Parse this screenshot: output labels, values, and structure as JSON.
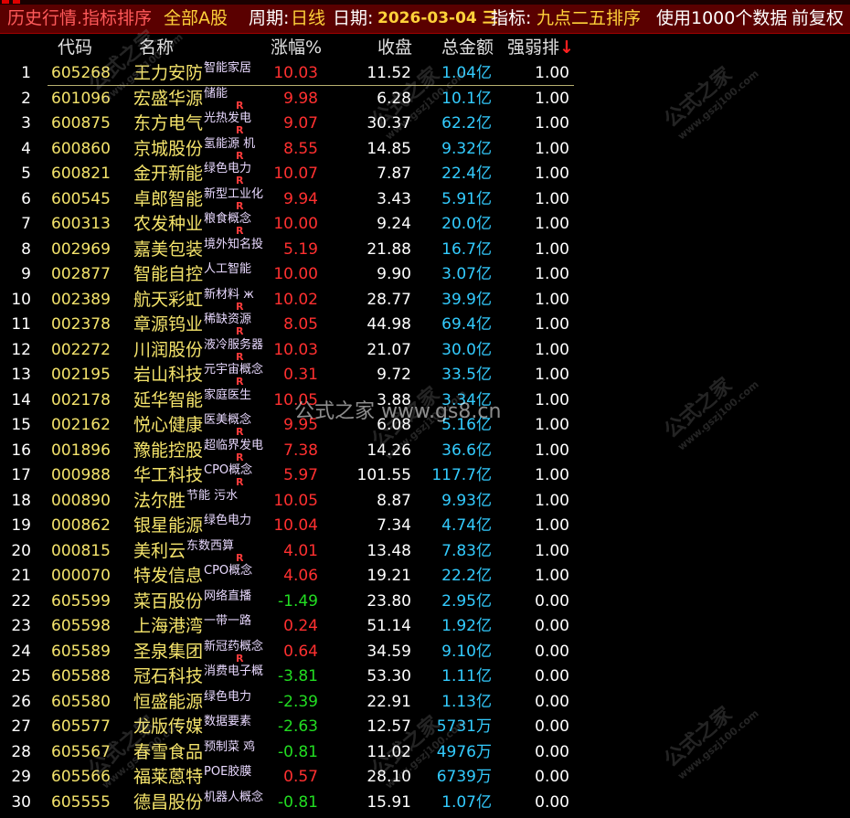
{
  "titlebar": {
    "module": "历史行情.指标排序",
    "scope": "全部A股",
    "period_label": "周期:",
    "period_value": "日线",
    "date_label": "日期:",
    "date_value": "2026-03-04 三",
    "indicator_label": "指标:",
    "indicator_value": "九点二五排序",
    "data_note": "使用1000个数据",
    "adjust": "前复权"
  },
  "columns": {
    "code": "代码",
    "name": "名称",
    "change": "涨幅%",
    "close": "收盘",
    "amount": "总金额",
    "rank": "强弱排",
    "sort_arrow": "↓"
  },
  "rows": [
    {
      "idx": "1",
      "code": "605268",
      "name": "王力安防",
      "concept": "智能家居",
      "r": "",
      "chg": "10.03",
      "dir": "up",
      "close": "11.52",
      "amt": "1.04亿",
      "rank": "1.00"
    },
    {
      "idx": "2",
      "code": "601096",
      "name": "宏盛华源",
      "concept": "储能",
      "r": "R",
      "chg": "9.98",
      "dir": "up",
      "close": "6.28",
      "amt": "10.1亿",
      "rank": "1.00"
    },
    {
      "idx": "3",
      "code": "600875",
      "name": "东方电气",
      "concept": "光热发电",
      "r": "R",
      "chg": "9.07",
      "dir": "up",
      "close": "30.37",
      "amt": "62.2亿",
      "rank": "1.00"
    },
    {
      "idx": "4",
      "code": "600860",
      "name": "京城股份",
      "concept": "氢能源 机",
      "r": "R",
      "chg": "8.55",
      "dir": "up",
      "close": "14.85",
      "amt": "9.32亿",
      "rank": "1.00"
    },
    {
      "idx": "5",
      "code": "600821",
      "name": "金开新能",
      "concept": "绿色电力",
      "r": "R",
      "chg": "10.07",
      "dir": "up",
      "close": "7.87",
      "amt": "22.4亿",
      "rank": "1.00"
    },
    {
      "idx": "6",
      "code": "600545",
      "name": "卓郎智能",
      "concept": "新型工业化",
      "r": "R",
      "chg": "9.94",
      "dir": "up",
      "close": "3.43",
      "amt": "5.91亿",
      "rank": "1.00"
    },
    {
      "idx": "7",
      "code": "600313",
      "name": "农发种业",
      "concept": "粮食概念",
      "r": "R",
      "chg": "10.00",
      "dir": "up",
      "close": "9.24",
      "amt": "20.0亿",
      "rank": "1.00"
    },
    {
      "idx": "8",
      "code": "002969",
      "name": "嘉美包装",
      "concept": "境外知名投",
      "r": "",
      "chg": "5.19",
      "dir": "up",
      "close": "21.88",
      "amt": "16.7亿",
      "rank": "1.00"
    },
    {
      "idx": "9",
      "code": "002877",
      "name": "智能自控",
      "concept": "人工智能",
      "r": "",
      "chg": "10.00",
      "dir": "up",
      "close": "9.90",
      "amt": "3.07亿",
      "rank": "1.00"
    },
    {
      "idx": "10",
      "code": "002389",
      "name": "航天彩虹",
      "concept": "新材料 ж",
      "r": "R",
      "chg": "10.02",
      "dir": "up",
      "close": "28.77",
      "amt": "39.9亿",
      "rank": "1.00"
    },
    {
      "idx": "11",
      "code": "002378",
      "name": "章源钨业",
      "concept": "稀缺资源",
      "r": "R",
      "chg": "8.05",
      "dir": "up",
      "close": "44.98",
      "amt": "69.4亿",
      "rank": "1.00"
    },
    {
      "idx": "12",
      "code": "002272",
      "name": "川润股份",
      "concept": "液冷服务器",
      "r": "R",
      "chg": "10.03",
      "dir": "up",
      "close": "21.07",
      "amt": "30.0亿",
      "rank": "1.00"
    },
    {
      "idx": "13",
      "code": "002195",
      "name": "岩山科技",
      "concept": "元宇宙概念",
      "r": "R",
      "chg": "0.31",
      "dir": "up",
      "close": "9.72",
      "amt": "33.5亿",
      "rank": "1.00"
    },
    {
      "idx": "14",
      "code": "002178",
      "name": "延华智能",
      "concept": "家庭医生",
      "r": "",
      "chg": "10.05",
      "dir": "up",
      "close": "3.88",
      "amt": "3.34亿",
      "rank": "1.00"
    },
    {
      "idx": "15",
      "code": "002162",
      "name": "悦心健康",
      "concept": "医美概念",
      "r": "R",
      "chg": "9.95",
      "dir": "up",
      "close": "6.08",
      "amt": "5.16亿",
      "rank": "1.00"
    },
    {
      "idx": "16",
      "code": "001896",
      "name": "豫能控股",
      "concept": "超临界发电",
      "r": "R",
      "chg": "7.38",
      "dir": "up",
      "close": "14.26",
      "amt": "36.6亿",
      "rank": "1.00"
    },
    {
      "idx": "17",
      "code": "000988",
      "name": "华工科技",
      "concept": "CPO概念",
      "r": "R",
      "chg": "5.97",
      "dir": "up",
      "close": "101.55",
      "amt": "117.7亿",
      "rank": "1.00"
    },
    {
      "idx": "18",
      "code": "000890",
      "name": "法尔胜",
      "concept": "节能 污水",
      "r": "",
      "chg": "10.05",
      "dir": "up",
      "close": "8.87",
      "amt": "9.93亿",
      "rank": "1.00"
    },
    {
      "idx": "19",
      "code": "000862",
      "name": "银星能源",
      "concept": "绿色电力",
      "r": "",
      "chg": "10.04",
      "dir": "up",
      "close": "7.34",
      "amt": "4.74亿",
      "rank": "1.00"
    },
    {
      "idx": "20",
      "code": "000815",
      "name": "美利云",
      "concept": "东数西算",
      "r": "R",
      "chg": "4.01",
      "dir": "up",
      "close": "13.48",
      "amt": "7.83亿",
      "rank": "1.00"
    },
    {
      "idx": "21",
      "code": "000070",
      "name": "特发信息",
      "concept": "CPO概念",
      "r": "",
      "chg": "4.06",
      "dir": "up",
      "close": "19.21",
      "amt": "22.2亿",
      "rank": "1.00"
    },
    {
      "idx": "22",
      "code": "605599",
      "name": "菜百股份",
      "concept": "网络直播",
      "r": "",
      "chg": "-1.49",
      "dir": "down",
      "close": "23.80",
      "amt": "2.95亿",
      "rank": "0.00"
    },
    {
      "idx": "23",
      "code": "605598",
      "name": "上海港湾",
      "concept": "一带一路",
      "r": "",
      "chg": "0.24",
      "dir": "up",
      "close": "51.14",
      "amt": "1.92亿",
      "rank": "0.00"
    },
    {
      "idx": "24",
      "code": "605589",
      "name": "圣泉集团",
      "concept": "新冠药概念",
      "r": "R",
      "chg": "0.64",
      "dir": "up",
      "close": "34.59",
      "amt": "9.10亿",
      "rank": "0.00"
    },
    {
      "idx": "25",
      "code": "605588",
      "name": "冠石科技",
      "concept": "消费电子概",
      "r": "",
      "chg": "-3.81",
      "dir": "down",
      "close": "53.30",
      "amt": "1.11亿",
      "rank": "0.00"
    },
    {
      "idx": "26",
      "code": "605580",
      "name": "恒盛能源",
      "concept": "绿色电力",
      "r": "",
      "chg": "-2.39",
      "dir": "down",
      "close": "22.91",
      "amt": "1.13亿",
      "rank": "0.00"
    },
    {
      "idx": "27",
      "code": "605577",
      "name": "龙版传媒",
      "concept": "数据要素",
      "r": "",
      "chg": "-2.63",
      "dir": "down",
      "close": "12.57",
      "amt": "5731万",
      "rank": "0.00"
    },
    {
      "idx": "28",
      "code": "605567",
      "name": "春雪食品",
      "concept": "预制菜 鸡",
      "r": "",
      "chg": "-0.81",
      "dir": "down",
      "close": "11.02",
      "amt": "4976万",
      "rank": "0.00"
    },
    {
      "idx": "29",
      "code": "605566",
      "name": "福莱蒽特",
      "concept": "POE胶膜",
      "r": "",
      "chg": "0.57",
      "dir": "up",
      "close": "28.10",
      "amt": "6739万",
      "rank": "0.00"
    },
    {
      "idx": "30",
      "code": "605555",
      "name": "德昌股份",
      "concept": "机器人概念",
      "r": "",
      "chg": "-0.81",
      "dir": "down",
      "close": "15.91",
      "amt": "1.07亿",
      "rank": "0.00"
    }
  ],
  "watermark": {
    "center_text": "公式之家 www.gs8.cn",
    "diag_text": "公式之家",
    "diag_url": "www.gszj100.com"
  },
  "colors": {
    "title_bg": "#5a0000",
    "code": "#f4e36b",
    "up": "#ff3030",
    "down": "#22dd22",
    "amount": "#33ccff"
  }
}
